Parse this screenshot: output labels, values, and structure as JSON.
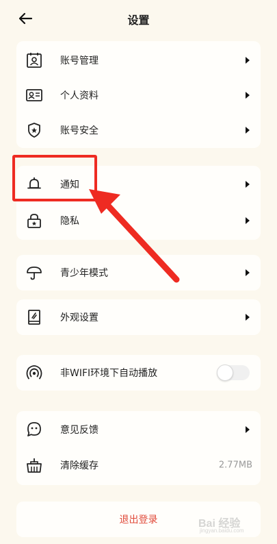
{
  "header": {
    "title": "设置"
  },
  "groups": [
    {
      "rows": [
        {
          "label": "账号管理",
          "icon": "account-manage-icon"
        },
        {
          "label": "个人资料",
          "icon": "profile-card-icon"
        },
        {
          "label": "账号安全",
          "icon": "shield-icon"
        }
      ]
    },
    {
      "rows": [
        {
          "label": "通知",
          "icon": "bell-icon"
        },
        {
          "label": "隐私",
          "icon": "privacy-lock-icon"
        }
      ]
    },
    {
      "rows": [
        {
          "label": "青少年模式",
          "icon": "umbrella-icon"
        }
      ]
    },
    {
      "rows": [
        {
          "label": "外观设置",
          "icon": "appearance-book-icon"
        }
      ]
    },
    {
      "rows": [
        {
          "label": "非WIFI环境下自动播放",
          "icon": "broadcast-icon",
          "toggle": false
        }
      ]
    },
    {
      "rows": [
        {
          "label": "意见反馈",
          "icon": "feedback-chat-icon"
        },
        {
          "label": "清除缓存",
          "icon": "clear-cache-basket-icon",
          "value": "2.77MB"
        }
      ]
    }
  ],
  "logout": {
    "label": "退出登录"
  },
  "colors": {
    "accent_red": "#e04a3a",
    "annotation_red": "#ee2b22",
    "background": "#fcf8ee"
  },
  "watermark": {
    "text": "Bai 经验",
    "sub": "jingyan.baidu.com"
  }
}
